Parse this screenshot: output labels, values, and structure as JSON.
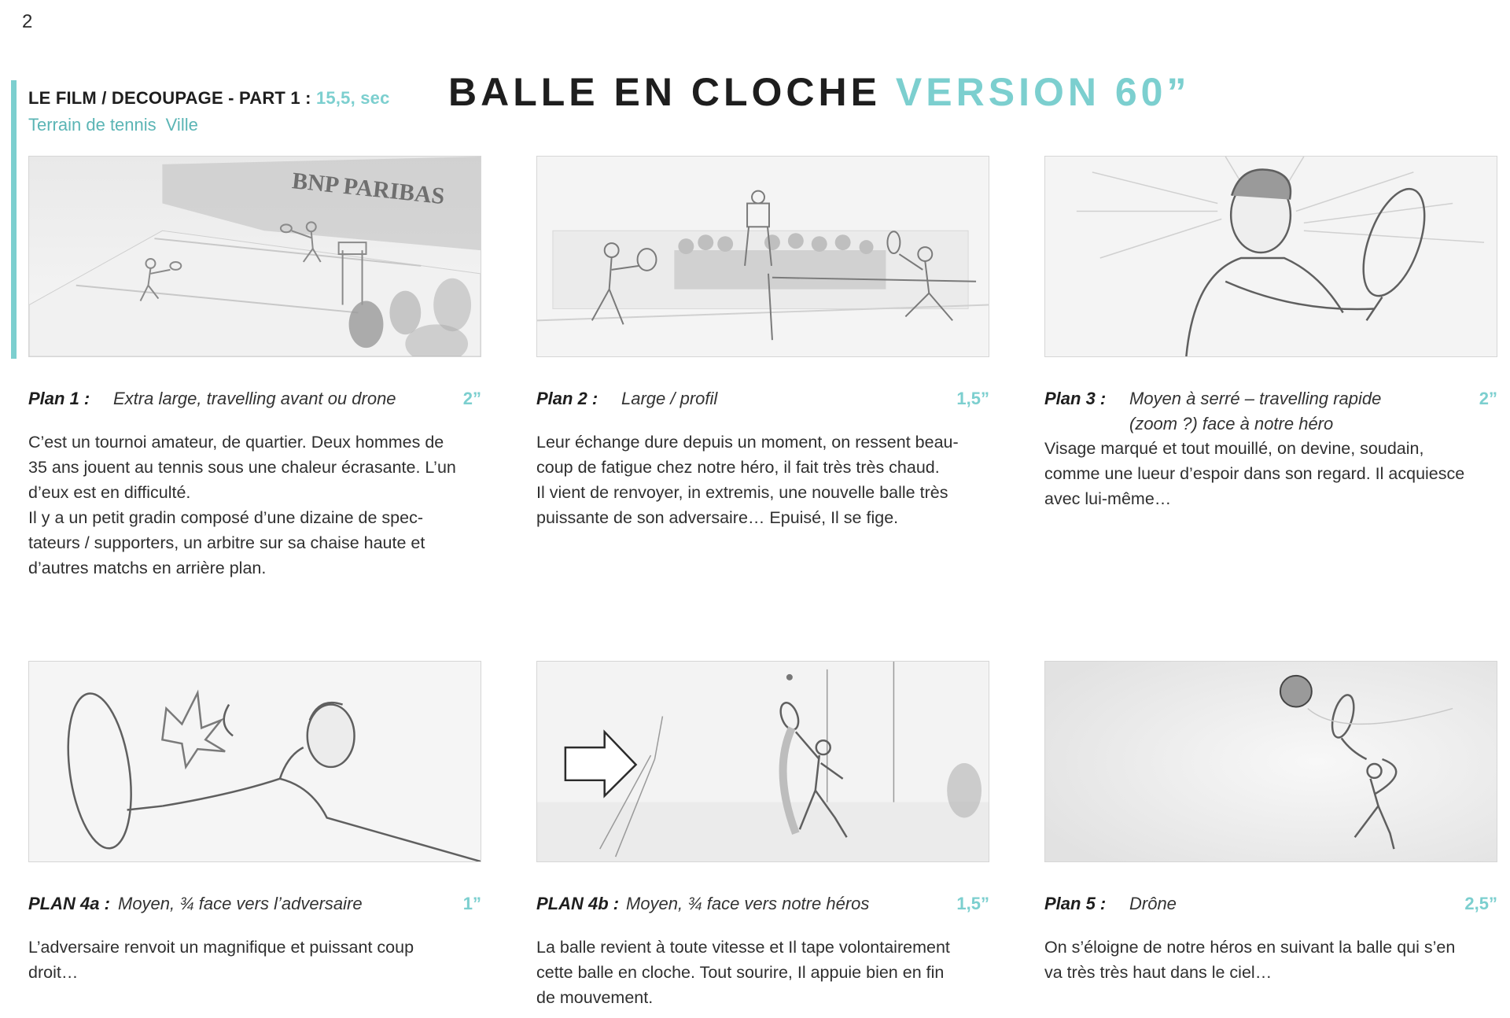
{
  "page_number": "2",
  "header": {
    "part_label": "LE FILM / DECOUPAGE - PART 1 : ",
    "part_duration": "15,5, sec",
    "location_1": "Terrain de tennis",
    "location_2": "Ville"
  },
  "title": {
    "main": "BALLE EN CLOCHE",
    "version": "VERSION 60”"
  },
  "panels": [
    {
      "label": "Plan 1 :",
      "description": "Extra large, travelling avant ou drone",
      "description_2": "",
      "duration": "2”",
      "text": [
        "C’est un tournoi amateur, de quartier. Deux hommes de",
        "35 ans  jouent au tennis sous une chaleur écrasante. L’un",
        "d’eux est en difficulté.",
        "Il y a un petit gradin composé d’une dizaine de spec-",
        "tateurs / supporters, un arbitre sur sa chaise haute et",
        "d’autres matchs en arrière plan."
      ],
      "banner_text": "BNP PARIBAS"
    },
    {
      "label": "Plan 2 :",
      "description": "Large / profil",
      "description_2": "",
      "duration": "1,5”",
      "text": [
        "Leur échange dure depuis un moment, on ressent beau-",
        "coup de fatigue chez notre héro, il fait très très chaud.",
        "Il vient de renvoyer, in extremis, une nouvelle balle très",
        "puissante de son adversaire…  Epuisé, Il se fige."
      ]
    },
    {
      "label": "Plan 3 :",
      "description": "Moyen à serré – travelling rapide",
      "description_2": "(zoom ?) face à notre héro",
      "duration": "2”",
      "text": [
        "Visage marqué et tout mouillé, on devine, soudain,",
        "comme une lueur d’espoir dans son regard. Il acquiesce",
        "avec lui-même…"
      ]
    },
    {
      "label": "PLAN 4a :",
      "description": "Moyen, ¾ face vers l’adversaire",
      "description_2": "",
      "duration": "1”",
      "text": [
        "L’adversaire renvoit un magnifique et puissant  coup",
        "droit…"
      ]
    },
    {
      "label": "PLAN 4b :",
      "description": "Moyen, ¾ face vers notre héros",
      "description_2": "",
      "duration": "1,5”",
      "text": [
        "La balle revient à toute vitesse et Il tape volontairement",
        "cette balle en cloche. Tout sourire, Il appuie bien en fin",
        "de  mouvement."
      ]
    },
    {
      "label": "Plan 5 :",
      "description": "Drône",
      "description_2": "",
      "duration": "2,5”",
      "text": [
        "On s’éloigne de notre héros en suivant la balle qui s’en",
        "va très très haut dans le ciel…"
      ]
    }
  ],
  "colors": {
    "accent": "#7ccfcf",
    "accent_dark": "#5bb5b5",
    "text": "#2b2b2b"
  }
}
